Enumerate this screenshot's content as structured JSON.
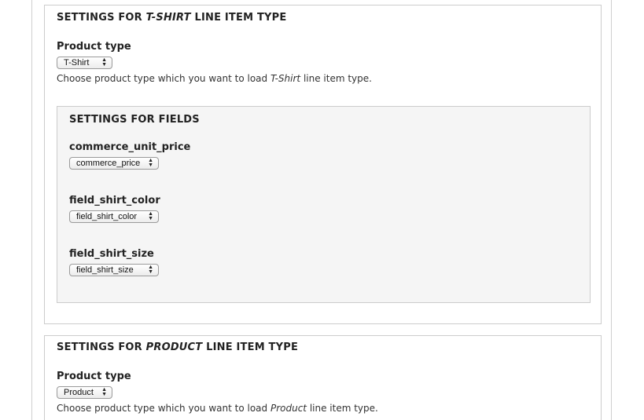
{
  "tshirt_section": {
    "legend_prefix": "SETTINGS FOR ",
    "legend_type": "T-SHIRT",
    "legend_suffix": " LINE ITEM TYPE",
    "product_type_label": "Product type",
    "product_type_value": "T-Shirt",
    "description_prefix": "Choose product type which you want to load ",
    "description_type": "T-Shirt",
    "description_suffix": " line item type.",
    "fields_section": {
      "legend": "SETTINGS FOR FIELDS",
      "fields": [
        {
          "label": "commerce_unit_price",
          "value": "commerce_price"
        },
        {
          "label": "field_shirt_color",
          "value": "field_shirt_color"
        },
        {
          "label": "field_shirt_size",
          "value": "field_shirt_size"
        }
      ]
    }
  },
  "product_section": {
    "legend_prefix": "SETTINGS FOR ",
    "legend_type": "PRODUCT",
    "legend_suffix": " LINE ITEM TYPE",
    "product_type_label": "Product type",
    "product_type_value": "Product",
    "description_prefix": "Choose product type which you want to load ",
    "description_type": "Product",
    "description_suffix": " line item type."
  },
  "icons": {
    "select_arrows": "updown-arrows-icon"
  }
}
